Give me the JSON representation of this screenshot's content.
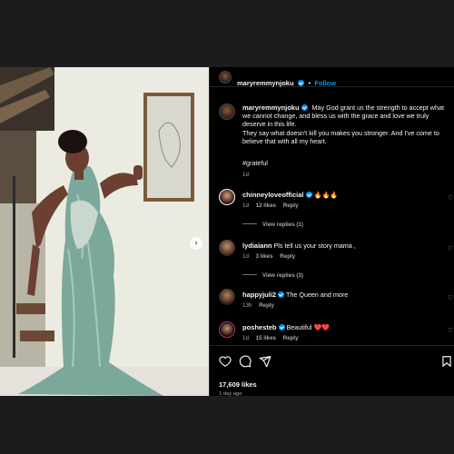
{
  "header": {
    "username": "maryremmynjoku",
    "dot": "•",
    "follow_label": "Follow"
  },
  "caption": {
    "username": "maryremmynjoku",
    "text1": "May God grant us the strength to accept what we cannot change, and bless us with the grace and love we truly deserve in this life.",
    "text2": "They say what doesn't kill you makes you stronger. And I've come to believe that with all my heart.",
    "hashtag": "#grateful",
    "time": "1d"
  },
  "comments": [
    {
      "username": "chinneyloveofficial",
      "verified": true,
      "text": "🔥🔥🔥",
      "time": "1d",
      "likes": "12 likes",
      "reply": "Reply",
      "view_replies": "View replies (1)"
    },
    {
      "username": "lydiaiann",
      "verified": false,
      "text": "Pls tell us your story mama ,",
      "time": "1d",
      "likes": "3 likes",
      "reply": "Reply",
      "view_replies": "View replies (3)"
    },
    {
      "username": "happyjuli2",
      "verified": true,
      "text": "The Queen and more",
      "time": "13h",
      "likes": "",
      "reply": "Reply"
    },
    {
      "username": "poshesteb",
      "verified": true,
      "text": "Beautiful ❤️❤️",
      "time": "1d",
      "likes": "15 likes",
      "reply": "Reply"
    }
  ],
  "actions": {
    "likes": "17,609 likes",
    "ago": "1 day ago"
  },
  "icons": [
    "heart-icon",
    "comment-icon",
    "share-icon",
    "bookmark-icon",
    "chevron-right-icon",
    "verified-icon"
  ],
  "colors": {
    "accent": "#0095f6",
    "background": "#000000",
    "page": "#1c1c1f",
    "muted": "#a8a8a8"
  }
}
